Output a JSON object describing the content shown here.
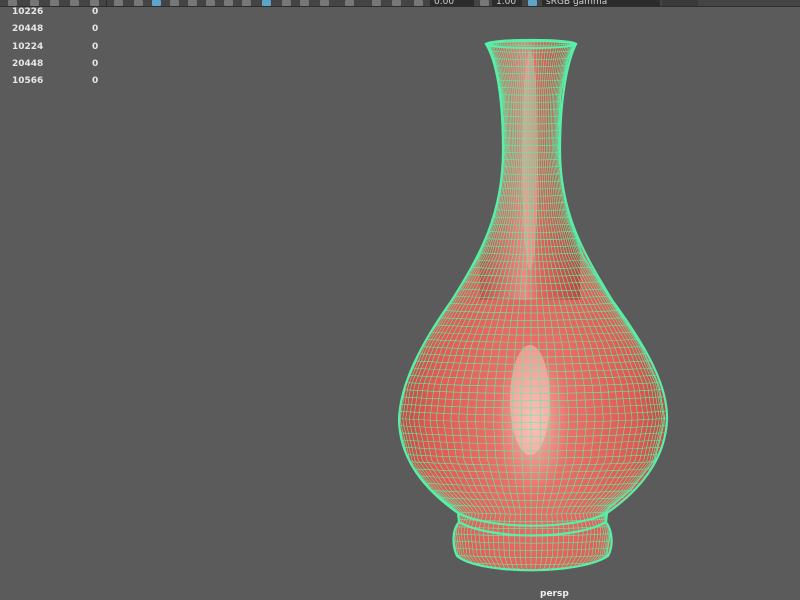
{
  "toolbar": {
    "color_management_value": "sRGB gamma",
    "field_a_value": "0.00",
    "field_b_value": "1.00"
  },
  "hud": {
    "rows": [
      {
        "value": "10226",
        "secondary": "0"
      },
      {
        "value": "20448",
        "secondary": "0"
      },
      {
        "value": "10224",
        "secondary": "0"
      },
      {
        "value": "20448",
        "secondary": "0"
      },
      {
        "value": "10566",
        "secondary": "0"
      }
    ]
  },
  "viewport": {
    "camera_label": "persp",
    "background_color": "#5b5b5b",
    "wireframe_color": "#57f0a8",
    "surface_color": "#e15a55"
  }
}
